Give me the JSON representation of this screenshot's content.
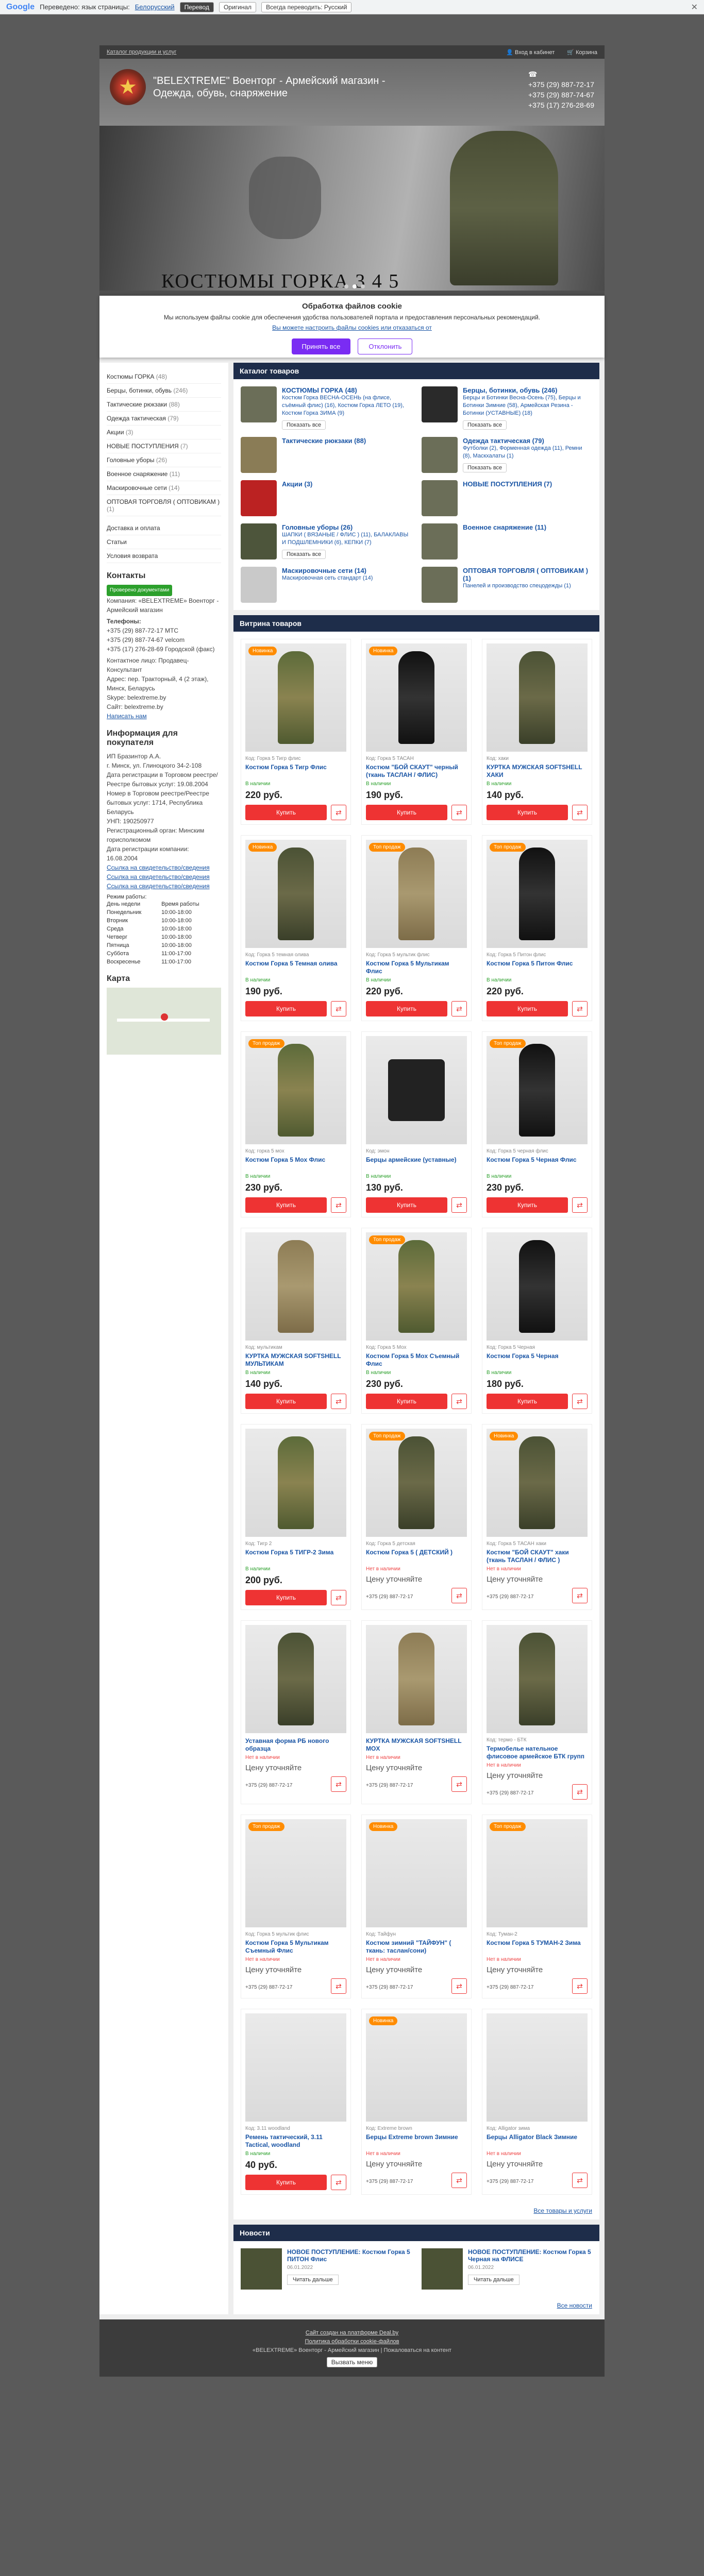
{
  "translate": {
    "logo": "Google",
    "text": "Переведено: язык страницы:",
    "lang": "Белорусский",
    "btn_translated": "Перевод",
    "btn_original": "Оригинал",
    "btn_always": "Всегда переводить: Русский"
  },
  "topbar": {
    "link": "Каталог продукции и услуг",
    "login": "Вход в кабинет",
    "cart": "Корзина"
  },
  "header": {
    "site_name": "\"BELEXTREME\" Военторг - Армейский магазин - Одежда, обувь, снаряжение",
    "phones": [
      "+375 (29) 887-72-17",
      "+375 (29) 887-74-67",
      "+375 (17) 276-28-69"
    ],
    "banner_title": "КОСТЮМЫ ГОРКА 3 4 5"
  },
  "cookie": {
    "title": "Обработка файлов cookie",
    "text": "Мы используем файлы cookie для обеспечения удобства пользователей портала и предоставления персональных рекомендаций.",
    "link": "Вы можете настроить файлы cookies или отказаться от",
    "accept": "Принять все",
    "decline": "Отклонить"
  },
  "sidebar": {
    "categories": [
      {
        "label": "Костюмы ГОРКА",
        "count": "(48)"
      },
      {
        "label": "Берцы, ботинки, обувь",
        "count": "(246)"
      },
      {
        "label": "Тактические рюкзаки",
        "count": "(88)"
      },
      {
        "label": "Одежда тактическая",
        "count": "(79)"
      },
      {
        "label": "Акции",
        "count": "(3)"
      },
      {
        "label": "НОВЫЕ ПОСТУПЛЕНИЯ",
        "count": "(7)"
      },
      {
        "label": "Головные уборы",
        "count": "(26)"
      },
      {
        "label": "Военное снаряжение",
        "count": "(11)"
      },
      {
        "label": "Маскировочные сети",
        "count": "(14)"
      },
      {
        "label": "ОПТОВАЯ ТОРГОВЛЯ ( ОПТОВИКАМ )",
        "count": "(1)"
      }
    ],
    "links": [
      "Доставка и оплата",
      "Статьи",
      "Условия возврата"
    ],
    "contacts_title": "Контакты",
    "verified": "Проверено документами",
    "company": "Компания: «BELEXTREME» Военторг - Армейский магазин",
    "phones_label": "Телефоны:",
    "phones": [
      "+375 (29) 887-72-17 МТС",
      "+375 (29) 887-74-67 velcom",
      "+375 (17) 276-28-69 Городской (факс)"
    ],
    "person": "Контактное лицо: Продавец-Консультант",
    "address": "Адрес: пер. Тракторный, 4 (2 этаж), Минск, Беларусь",
    "skype": "Skype: belextreme.by",
    "site": "Сайт: belextreme.by",
    "feedback": "Написать нам",
    "buyers_title": "Информация для покупателя",
    "buyer_lines": [
      "ИП Бразинтор А.А.",
      "г. Минск, ул. Глиноцкого 34-2-108",
      "Дата регистрации в Торговом реестре/Реестре бытовых услуг: 19.08.2004",
      "Номер в Торговом реестре/Реестре бытовых услуг: 1714, Республика Беларусь",
      "УНП: 190250977",
      "Регистрационный орган: Минским горисполкомом",
      "Дата регистрации компании: 16.08.2004"
    ],
    "cert_links": [
      "Ссылка на свидетельство/сведения",
      "Ссылка на свидетельство/сведения",
      "Ссылка на свидетельство/сведения"
    ],
    "hours_title": "Режим работы:",
    "hours": [
      [
        "День недели",
        "Время работы"
      ],
      [
        "Понедельник",
        "10:00-18:00"
      ],
      [
        "Вторник",
        "10:00-18:00"
      ],
      [
        "Среда",
        "10:00-18:00"
      ],
      [
        "Четверг",
        "10:00-18:00"
      ],
      [
        "Пятница",
        "10:00-18:00"
      ],
      [
        "Суббота",
        "11:00-17:00"
      ],
      [
        "Воскресенье",
        "11:00-17:00"
      ]
    ],
    "map_title": "Карта"
  },
  "catalog": {
    "title": "Каталог товаров",
    "items": [
      {
        "title": "КОСТЮМЫ ГОРКА",
        "count": "(48)",
        "sub": "Костюм Горка ВЕСНА-ОСЕНЬ (на флисе, съёмный флис) (16), Костюм Горка ЛЕТО (19), Костюм Горка ЗИМА (9)",
        "show": "Показать все",
        "thumb": ""
      },
      {
        "title": "Берцы, ботинки, обувь",
        "count": "(246)",
        "sub": "Берцы и Ботинки Весна-Осень (75), Берцы и Ботинки Зимние (58), Армейская Резина - Ботинки (УСТАВНЫЕ) (18)",
        "show": "Показать все",
        "thumb": "boots"
      },
      {
        "title": "Тактические рюкзаки",
        "count": "(88)",
        "sub": "",
        "show": "",
        "thumb": "bags"
      },
      {
        "title": "Одежда тактическая",
        "count": "(79)",
        "sub": "Футболки (2), Форменная одежда (11), Ремни (8), Маскхалаты (1)",
        "show": "Показать все",
        "thumb": ""
      },
      {
        "title": "Акции",
        "count": "(3)",
        "sub": "",
        "show": "",
        "thumb": "promo"
      },
      {
        "title": "НОВЫЕ ПОСТУПЛЕНИЯ",
        "count": "(7)",
        "sub": "",
        "show": "",
        "thumb": ""
      },
      {
        "title": "Головные уборы",
        "count": "(26)",
        "sub": "ШАПКИ ( ВЯЗАНЫЕ / ФЛИС ) (11), БАЛАКЛАВЫ И ПОДШЛЕМНИКИ (6), КЕПКИ (7)",
        "show": "Показать все",
        "thumb": "hat"
      },
      {
        "title": "Военное снаряжение",
        "count": "(11)",
        "sub": "",
        "show": "",
        "thumb": ""
      },
      {
        "title": "Маскировочные сети",
        "count": "(14)",
        "sub": "Маскировочная сеть стандарт (14)",
        "show": "",
        "thumb": "tape"
      },
      {
        "title": "ОПТОВАЯ ТОРГОВЛЯ ( ОПТОВИКАМ )",
        "count": "(1)",
        "sub": "Панелей и производство спецодежды (1)",
        "show": "",
        "thumb": ""
      }
    ]
  },
  "showcase": {
    "title": "Витрина товаров",
    "buy": "Купить",
    "compare_icon": "⇄",
    "products": [
      {
        "badge": "Новинка",
        "code": "Код: Горка 5 Тигр флис",
        "name": "Костюм Горка 5 Тигр Флис",
        "avail": "В наличии",
        "price": "220 руб.",
        "fig": "camo"
      },
      {
        "badge": "Новинка",
        "code": "Код: Горка 5 ТАСАН",
        "name": "Костюм \"БОЙ СКАУТ\" черный (ткань ТАСЛАН / ФЛИС)",
        "avail": "В наличии",
        "price": "190 руб.",
        "fig": "black"
      },
      {
        "badge": "",
        "code": "Код: хаки",
        "name": "КУРТКА МУЖСКАЯ SOFTSHELL ХАКИ",
        "avail": "В наличии",
        "price": "140 руб.",
        "fig": ""
      },
      {
        "badge": "Новинка",
        "code": "Код: Горка 5 темная олива",
        "name": "Костюм Горка 5 Темная олива",
        "avail": "В наличии",
        "price": "190 руб.",
        "fig": ""
      },
      {
        "badge": "Топ продаж",
        "code": "Код: Горка 5 мультик флис",
        "name": "Костюм Горка 5 Мультикам Флис",
        "avail": "В наличии",
        "price": "220 руб.",
        "fig": "tan"
      },
      {
        "badge": "Топ продаж",
        "code": "Код: Горка 5 Питон флис",
        "name": "Костюм Горка 5 Питон Флис",
        "avail": "В наличии",
        "price": "220 руб.",
        "fig": "black"
      },
      {
        "badge": "Топ продаж",
        "code": "Код: горка 5 мох",
        "name": "Костюм Горка 5 Mox Флис",
        "avail": "В наличии",
        "price": "230 руб.",
        "fig": "camo"
      },
      {
        "badge": "",
        "code": "Код: эмон",
        "name": "Берцы армейские (уставные)",
        "avail": "В наличии",
        "price": "130 руб.",
        "fig": "boot"
      },
      {
        "badge": "Топ продаж",
        "code": "Код: Горка 5 черная флис",
        "name": "Костюм Горка 5 Черная Флис",
        "avail": "В наличии",
        "price": "230 руб.",
        "fig": "black"
      },
      {
        "badge": "",
        "code": "Код: мультикам",
        "name": "КУРТКА МУЖСКАЯ SOFTSHELL МУЛЬТИКАМ",
        "avail": "В наличии",
        "price": "140 руб.",
        "fig": "tan"
      },
      {
        "badge": "Топ продаж",
        "code": "Код: Горка 5 Мох",
        "name": "Костюм Горка 5 Mox Съемный Флис",
        "avail": "В наличии",
        "price": "230 руб.",
        "fig": "camo"
      },
      {
        "badge": "",
        "code": "Код: Горка 5 Черная",
        "name": "Костюм Горка 5 Черная",
        "avail": "В наличии",
        "price": "180 руб.",
        "fig": "black"
      },
      {
        "badge": "",
        "code": "Код: Тигр 2",
        "name": "Костюм Горка 5 ТИГР-2 Зима",
        "avail": "В наличии",
        "price": "200 руб.",
        "fig": "camo"
      },
      {
        "badge": "Топ продаж",
        "code": "Код: Горка 5 детская",
        "name": "Костюм Горка 5 ( ДЕТСКИЙ )",
        "avail": "Нет в наличии",
        "price": "Цену уточняйте",
        "fig": ""
      },
      {
        "badge": "Новинка",
        "code": "Код: Горка 5 ТАСАН хаки",
        "name": "Костюм \"БОЙ СКАУТ\" хаки (ткань ТАСЛАН / ФЛИС )",
        "avail": "Нет в наличии",
        "price": "Цену уточняйте",
        "fig": ""
      },
      {
        "badge": "",
        "code": "",
        "name": "Уставная форма РБ нового образца",
        "avail": "Нет в наличии",
        "price": "Цену уточняйте",
        "fig": ""
      },
      {
        "badge": "",
        "code": "",
        "name": "КУРТКА МУЖСКАЯ SOFTSHELL MOX",
        "avail": "Нет в наличии",
        "price": "Цену уточняйте",
        "fig": "tan"
      },
      {
        "badge": "",
        "code": "Код: термо - БТК",
        "name": "Термобелье нательное флисовое армейское БТК групп",
        "avail": "Нет в наличии",
        "price": "Цену уточняйте",
        "fig": ""
      },
      {
        "badge": "Топ продаж",
        "code": "Код: Горка 5 мультик флис",
        "name": "Костюм Горка 5 Мультикам Съемный Флис",
        "avail": "Нет в наличии",
        "price": "Цену уточняйте",
        "fig": "none"
      },
      {
        "badge": "Новинка",
        "code": "Код: Тайфун",
        "name": "Костюм зимний \"ТАЙФУН\" ( ткань: таслан/сони)",
        "avail": "Нет в наличии",
        "price": "Цену уточняйте",
        "fig": "none"
      },
      {
        "badge": "Топ продаж",
        "code": "Код: Туман-2",
        "name": "Костюм Горка 5 ТУМАН-2 Зима",
        "avail": "Нет в наличии",
        "price": "Цену уточняйте",
        "fig": "none"
      },
      {
        "badge": "",
        "code": "Код: 3.11 woodland",
        "name": "Ремень тактический, 3.11 Tactical, woodland",
        "avail": "В наличии",
        "price": "40 руб.",
        "fig": "none"
      },
      {
        "badge": "Новинка",
        "code": "Код: Extreme brown",
        "name": "Берцы Extreme brown Зимние",
        "avail": "Нет в наличии",
        "price": "Цену уточняйте",
        "fig": "none"
      },
      {
        "badge": "",
        "code": "Код: Alligator зима",
        "name": "Берцы Alligator Black Зимние",
        "avail": "Нет в наличии",
        "price": "Цену уточняйте",
        "fig": "none"
      }
    ],
    "phone": "+375 (29) 887-72-17",
    "all": "Все товары и услуги"
  },
  "news": {
    "title": "Новости",
    "items": [
      {
        "title": "НОВОЕ ПОСТУПЛЕНИЕ: Костюм Горка 5 ПИТОН Флис",
        "date": "06.01.2022",
        "more": "Читать дальше"
      },
      {
        "title": "НОВОЕ ПОСТУПЛЕНИЕ: Костюм Горка 5 Черная на ФЛИСЕ",
        "date": "06.01.2022",
        "more": "Читать дальше"
      }
    ],
    "all": "Все новости"
  },
  "footer": {
    "lines": [
      "Сайт создан на платформе Deal.by",
      "Политика обработки cookie-файлов",
      "«BELEXTREME» Военторг - Армейский магазин | Пожаловаться на контент"
    ],
    "btn": "Вызвать меню"
  }
}
